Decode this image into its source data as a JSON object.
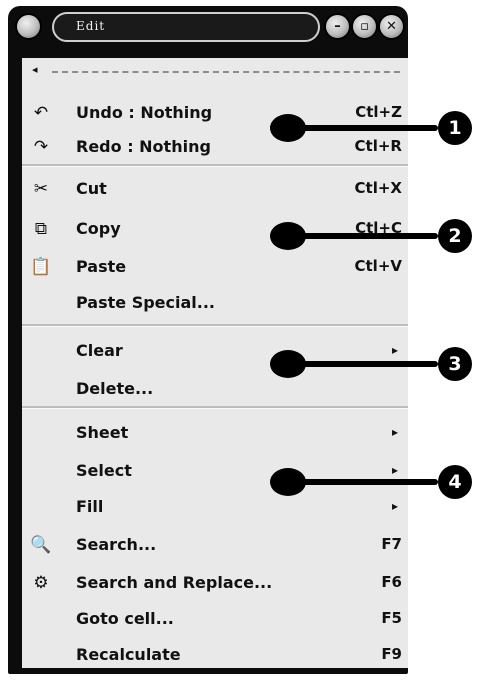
{
  "window": {
    "title": "Edit",
    "menu_icon": "window-menu-icon",
    "buttons": [
      {
        "name": "minimize-button",
        "glyph": "–"
      },
      {
        "name": "maximize-button",
        "glyph": "▫"
      },
      {
        "name": "close-button",
        "glyph": "✕"
      }
    ]
  },
  "menu": {
    "tearoff_arrow": "◂",
    "groups": [
      {
        "callout": "1",
        "items": [
          {
            "label": "Undo : Nothing",
            "accel": "Ctl+Z",
            "icon": "undo-icon",
            "glyph": "↶"
          },
          {
            "label": "Redo : Nothing",
            "accel": "Ctl+R",
            "icon": "redo-icon",
            "glyph": "↷"
          }
        ]
      },
      {
        "callout": "2",
        "items": [
          {
            "label": "Cut",
            "accel": "Ctl+X",
            "icon": "cut-icon",
            "glyph": "✂"
          },
          {
            "label": "Copy",
            "accel": "Ctl+C",
            "icon": "copy-icon",
            "glyph": "⧉"
          },
          {
            "label": "Paste",
            "accel": "Ctl+V",
            "icon": "paste-icon",
            "glyph": "📋"
          },
          {
            "label": "Paste Special...",
            "accel": "",
            "icon": "",
            "glyph": ""
          }
        ]
      },
      {
        "callout": "3",
        "items": [
          {
            "label": "Clear",
            "accel": "",
            "submenu": true
          },
          {
            "label": "Delete...",
            "accel": ""
          }
        ]
      },
      {
        "callout": "4",
        "items": [
          {
            "label": "Sheet",
            "accel": "",
            "submenu": true
          },
          {
            "label": "Select",
            "accel": "",
            "submenu": true
          },
          {
            "label": "Fill",
            "accel": "",
            "submenu": true
          },
          {
            "label": "Search...",
            "accel": "F7",
            "icon": "search-icon",
            "glyph": "🔍"
          },
          {
            "label": "Search and Replace...",
            "accel": "F6",
            "icon": "search-replace-icon",
            "glyph": "⚙"
          },
          {
            "label": "Goto cell...",
            "accel": "F5"
          },
          {
            "label": "Recalculate",
            "accel": "F9"
          }
        ]
      }
    ],
    "submenu_arrow": "▸"
  }
}
